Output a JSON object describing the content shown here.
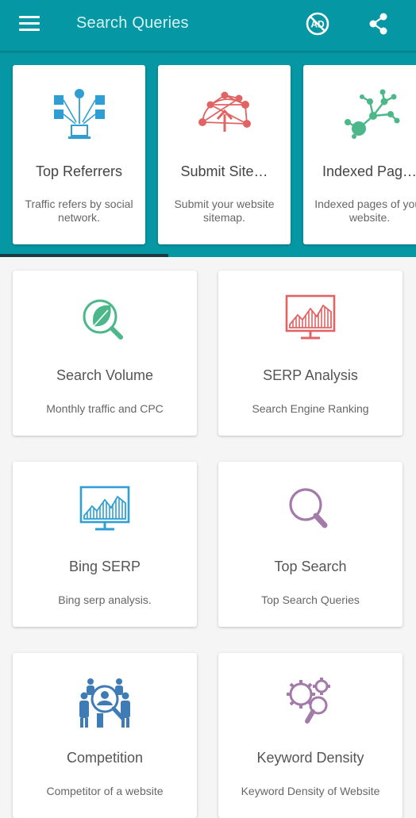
{
  "app_bar": {
    "title": "Search Queries",
    "menu_icon": "hamburger-menu-icon",
    "noads_icon": "remove-ads-icon",
    "share_icon": "share-icon",
    "background": "#0597a3"
  },
  "top_cards": [
    {
      "title": "Top Referrers",
      "description": "Traffic refers by social network.",
      "icon": "social-referrers-icon",
      "icon_color": "#2f9fd3"
    },
    {
      "title": "Submit Site…",
      "description": "Submit your website sitemap.",
      "icon": "network-upload-icon",
      "icon_color": "#e06464"
    },
    {
      "title": "Indexed Pag…",
      "description": "Indexed pages of your website.",
      "icon": "node-tree-icon",
      "icon_color": "#4cb88a"
    }
  ],
  "grid_cards": [
    {
      "title": "Search Volume",
      "description": "Monthly traffic and CPC",
      "icon": "leaf-magnifier-icon",
      "icon_color": "#4cb88a"
    },
    {
      "title": "SERP Analysis",
      "description": "Search Engine Ranking",
      "icon": "monitor-chart-icon",
      "icon_color": "#e06464"
    },
    {
      "title": "Bing SERP",
      "description": "Bing serp analysis.",
      "icon": "monitor-chart-icon",
      "icon_color": "#2f9fd3"
    },
    {
      "title": "Top Search",
      "description": "Top Search Queries",
      "icon": "magnifier-icon",
      "icon_color": "#a37aa9"
    },
    {
      "title": "Competition",
      "description": "Competitor of a website",
      "icon": "team-magnifier-icon",
      "icon_color": "#3f7cb5"
    },
    {
      "title": "Keyword Density",
      "description": "Keyword Density of Website",
      "icon": "gears-magnifier-icon",
      "icon_color": "#a37aa9"
    }
  ]
}
